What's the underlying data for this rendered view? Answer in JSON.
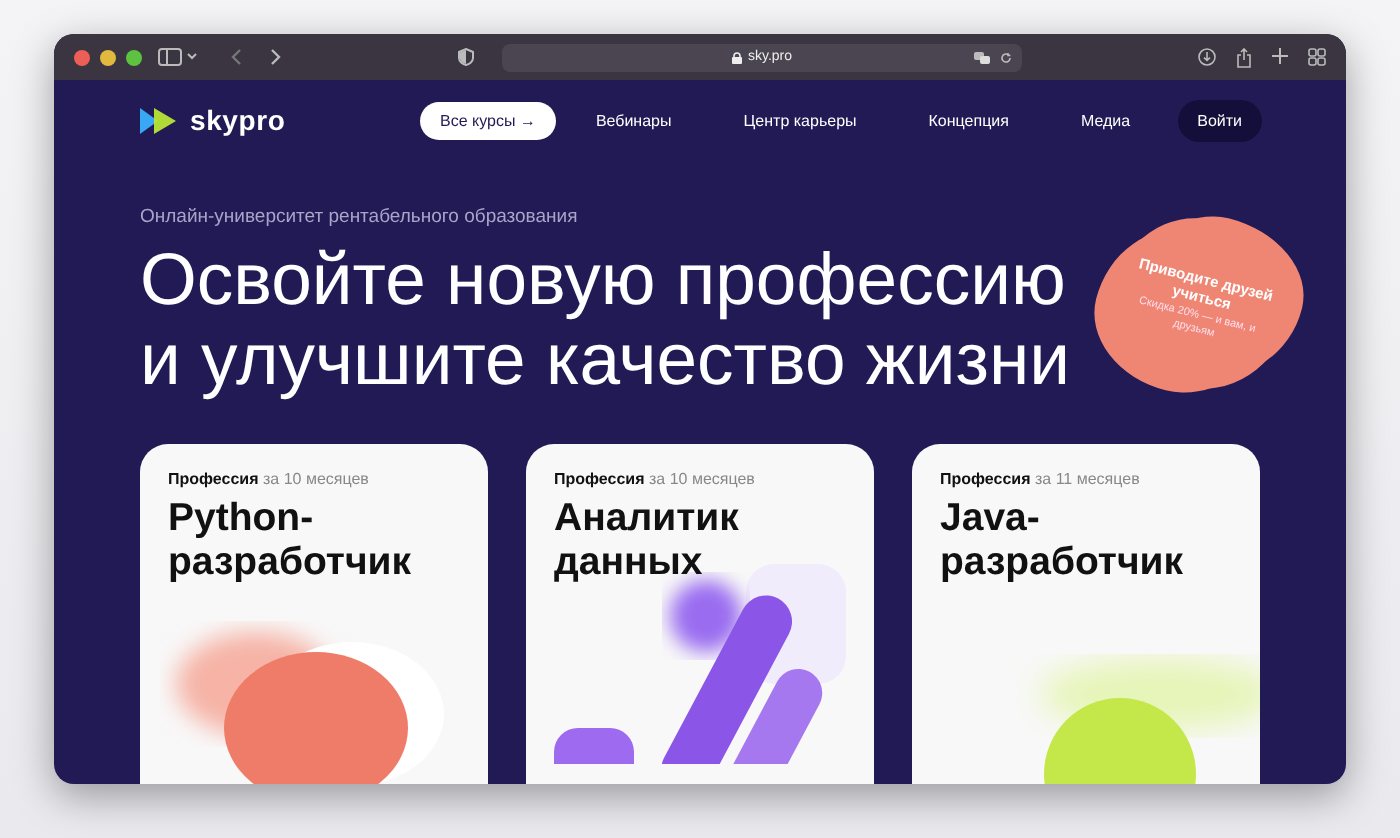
{
  "browser": {
    "url": "sky.pro"
  },
  "nav": {
    "logo": "skypro",
    "items": [
      {
        "label": "Все курсы",
        "selected": true,
        "arrow": "→"
      },
      {
        "label": "Вебинары",
        "selected": false
      },
      {
        "label": "Центр карьеры",
        "selected": false
      },
      {
        "label": "Концепция",
        "selected": false
      },
      {
        "label": "Медиа",
        "selected": false
      }
    ],
    "login": "Войти"
  },
  "hero": {
    "eyebrow": "Онлайн-университет рентабельного образования",
    "title_lines": [
      "Освойте новую профессию",
      "и улучшите качество жизни"
    ]
  },
  "promo": {
    "title": "Приводите друзей учиться",
    "text": "Скидка 20% — и вам, и друзьям"
  },
  "cards": [
    {
      "kind": "coral",
      "label": "Профессия",
      "duration": "за 10 месяцев",
      "title_lines": [
        "Python-",
        "разработчик"
      ]
    },
    {
      "kind": "bars",
      "label": "Профессия",
      "duration": "за 10 месяцев",
      "title_lines": [
        "Аналитик",
        "данных"
      ]
    },
    {
      "kind": "lime",
      "label": "Профессия",
      "duration": "за 11 месяцев",
      "title_lines": [
        "Java-",
        "разработчик"
      ]
    }
  ]
}
